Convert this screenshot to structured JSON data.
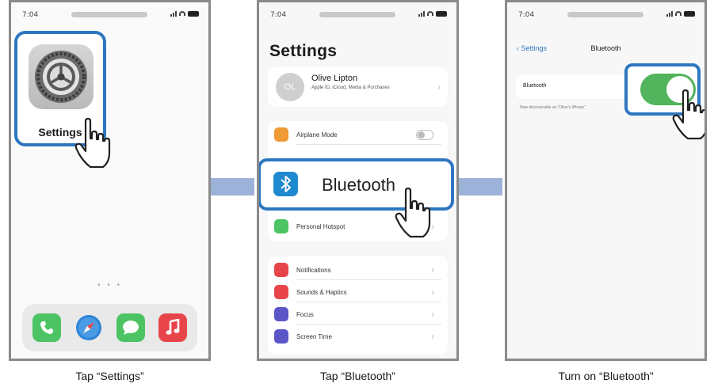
{
  "status_time": "7:04",
  "steps": [
    {
      "caption": "Tap “Settings”",
      "app_label": "Settings",
      "dots": "• • •",
      "dock_icons": [
        "phone-icon",
        "safari-icon",
        "messages-icon",
        "music-icon"
      ]
    },
    {
      "caption": "Tap “Bluetooth”",
      "title": "Settings",
      "profile": {
        "initials": "OL",
        "name": "Olive Lipton",
        "subtitle": "Apple ID, iCloud, Media & Purchases"
      },
      "rows": [
        {
          "label": "Airplane Mode",
          "icon": "airplane-icon",
          "color": "#f09a37"
        },
        {
          "label": "Personal Hotspot",
          "icon": "hotspot-icon",
          "color": "#4cc463"
        },
        {
          "label": "Notifications",
          "icon": "notifications-icon",
          "color": "#e8454a"
        },
        {
          "label": "Sounds & Haptics",
          "icon": "sounds-icon",
          "color": "#e8454a"
        },
        {
          "label": "Focus",
          "icon": "focus-icon",
          "color": "#5b56c7"
        },
        {
          "label": "Screen Time",
          "icon": "screen-time-icon",
          "color": "#5b56c7"
        }
      ],
      "bluetooth_label": "Bluetooth"
    },
    {
      "caption": "Turn on “Bluetooth”",
      "back_label": "Settings",
      "nav_title": "Bluetooth",
      "row_label": "Bluetooth",
      "row_caption": "Now discoverable as “Olive’s iPhone”.",
      "bluetooth_on": true
    }
  ],
  "colors": {
    "callout_border": "#2e77c0",
    "connector": "#9db2d8",
    "toggle_on": "#52b45c",
    "bluetooth_icon": "#1e88d0"
  }
}
